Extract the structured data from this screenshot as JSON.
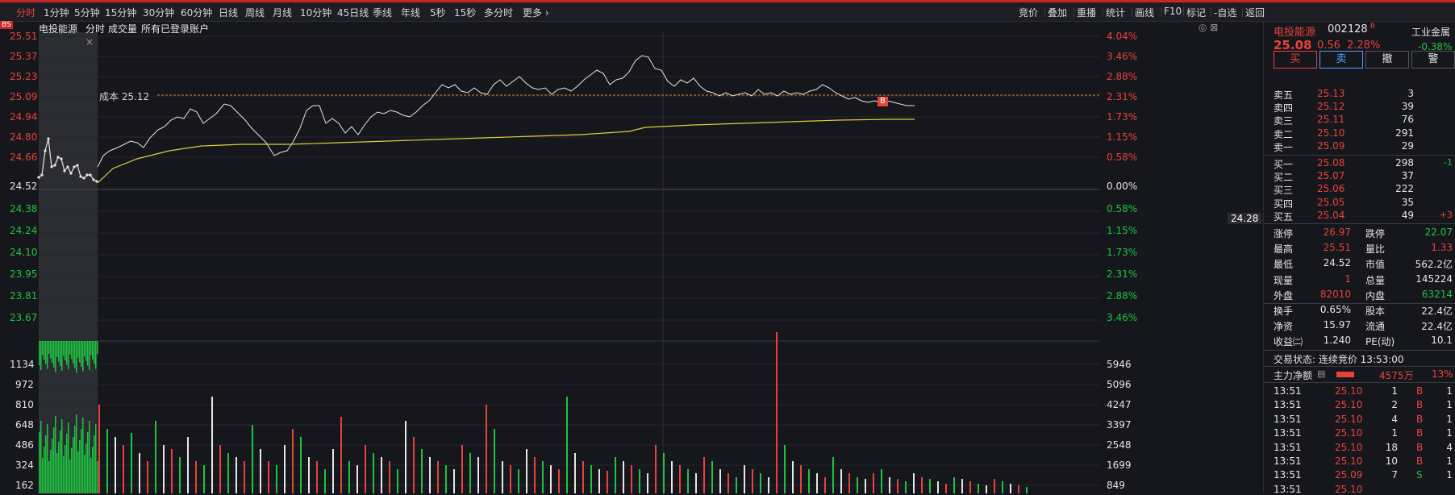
{
  "toolbar": {
    "left_items": [
      "分时",
      "1分钟",
      "5分钟",
      "15分钟",
      "30分钟",
      "60分钟",
      "日线",
      "周线",
      "月线",
      "10分钟",
      "45日线",
      "季线",
      "年线",
      "5秒",
      "15秒",
      "多分时",
      "更多 ›"
    ],
    "right_items": [
      "竞价",
      "叠加",
      "重播",
      "统计",
      "画线",
      "F10",
      "标记",
      "-自选",
      "返回"
    ]
  },
  "chart": {
    "badge": "BS",
    "header": {
      "stock_name": "电投能源",
      "mode": "分时",
      "series_label": "成交量",
      "account_label": "所有已登录账户"
    },
    "cost_label": "成本 25.12",
    "b_marker": "B",
    "price_axis_left": [
      "25.51",
      "25.37",
      "25.23",
      "25.09",
      "24.94",
      "24.80",
      "24.66",
      "24.52",
      "24.38",
      "24.24",
      "24.10",
      "23.95",
      "23.81",
      "23.67"
    ],
    "pct_axis_right": [
      "4.04%",
      "3.46%",
      "2.88%",
      "2.31%",
      "1.73%",
      "1.15%",
      "0.58%",
      "0.00%",
      "0.58%",
      "1.15%",
      "1.73%",
      "2.31%",
      "2.88%",
      "3.46%"
    ],
    "prev_close_tag": "24.28",
    "volume_axis_left": [
      "1134",
      "972",
      "810",
      "648",
      "486",
      "324",
      "162"
    ],
    "volume_axis_right": [
      "5946",
      "5096",
      "4247",
      "3397",
      "2548",
      "1699",
      "849"
    ],
    "colors": {
      "up": "#e8433a",
      "down": "#1ec43f",
      "price_line": "#e6e6e6",
      "avg_line": "#d9d13a",
      "cost_line": "#d88b3a"
    }
  },
  "panel": {
    "title": "电投能源",
    "code": "002128",
    "r_mark": "R",
    "industry": "工业金属",
    "price": "25.08",
    "change": "0.56",
    "change_pct": "2.28%",
    "industry_pct": "-0.38%",
    "trade_buttons": [
      "买",
      "卖",
      "撤",
      "警"
    ],
    "asks": [
      {
        "label": "卖五",
        "price": "25.13",
        "vol": "3",
        "delta": ""
      },
      {
        "label": "卖四",
        "price": "25.12",
        "vol": "39",
        "delta": ""
      },
      {
        "label": "卖三",
        "price": "25.11",
        "vol": "76",
        "delta": ""
      },
      {
        "label": "卖二",
        "price": "25.10",
        "vol": "291",
        "delta": ""
      },
      {
        "label": "卖一",
        "price": "25.09",
        "vol": "29",
        "delta": ""
      }
    ],
    "bids": [
      {
        "label": "买一",
        "price": "25.08",
        "vol": "298",
        "delta": "-1"
      },
      {
        "label": "买二",
        "price": "25.07",
        "vol": "37",
        "delta": ""
      },
      {
        "label": "买三",
        "price": "25.06",
        "vol": "222",
        "delta": ""
      },
      {
        "label": "买四",
        "price": "25.05",
        "vol": "35",
        "delta": ""
      },
      {
        "label": "买五",
        "price": "25.04",
        "vol": "49",
        "delta": "+3"
      }
    ],
    "stats": [
      {
        "l1": "涨停",
        "v1": "26.97",
        "c1": "red",
        "l2": "跌停",
        "v2": "22.07",
        "c2": "green"
      },
      {
        "l1": "最高",
        "v1": "25.51",
        "c1": "red",
        "l2": "量比",
        "v2": "1.33",
        "c2": "red"
      },
      {
        "l1": "最低",
        "v1": "24.52",
        "c1": "white",
        "l2": "市值",
        "v2": "562.2亿",
        "c2": "white"
      },
      {
        "l1": "现量",
        "v1": "1",
        "c1": "red",
        "l2": "总量",
        "v2": "145224",
        "c2": "white"
      },
      {
        "l1": "外盘",
        "v1": "82010",
        "c1": "red",
        "l2": "内盘",
        "v2": "63214",
        "c2": "green"
      },
      {
        "l1": "换手",
        "v1": "0.65%",
        "c1": "white",
        "l2": "股本",
        "v2": "22.4亿",
        "c2": "white"
      },
      {
        "l1": "净资",
        "v1": "15.97",
        "c1": "white",
        "l2": "流通",
        "v2": "22.4亿",
        "c2": "white"
      },
      {
        "l1": "收益㈡",
        "v1": "1.240",
        "c1": "white",
        "l2": "PE(动)",
        "v2": "10.1",
        "c2": "white"
      }
    ],
    "trade_status": "交易状态: 连续竞价 13:53:00",
    "main_flow_label": "主力净额",
    "main_flow_value": "4575万",
    "main_flow_pct": "13%",
    "ticks": [
      {
        "time": "13:51",
        "price": "25.10",
        "vol": "1",
        "side": "B",
        "n": "1"
      },
      {
        "time": "13:51",
        "price": "25.10",
        "vol": "2",
        "side": "B",
        "n": "1"
      },
      {
        "time": "13:51",
        "price": "25.10",
        "vol": "4",
        "side": "B",
        "n": "1"
      },
      {
        "time": "13:51",
        "price": "25.10",
        "vol": "1",
        "side": "B",
        "n": "1"
      },
      {
        "time": "13:51",
        "price": "25.10",
        "vol": "18",
        "side": "B",
        "n": "4"
      },
      {
        "time": "13:51",
        "price": "25.10",
        "vol": "10",
        "side": "B",
        "n": "1"
      },
      {
        "time": "13:51",
        "price": "25.09",
        "vol": "7",
        "side": "S",
        "n": "1"
      },
      {
        "time": "13:51",
        "price": "25.10",
        "vol": "",
        "side": "",
        "n": ""
      }
    ]
  }
}
